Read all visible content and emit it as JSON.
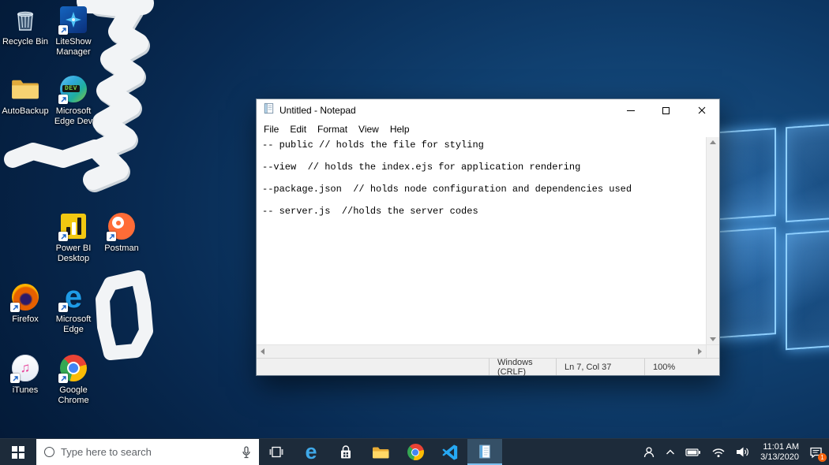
{
  "desktop": {
    "icons": [
      {
        "label": "Recycle Bin"
      },
      {
        "label": "LiteShow Manager"
      },
      {
        "label": "AutoBackup"
      },
      {
        "label": "Microsoft Edge Dev",
        "badge": "DEV"
      },
      {
        "label": "Power BI Desktop"
      },
      {
        "label": "Postman"
      },
      {
        "label": "Firefox"
      },
      {
        "label": "Microsoft Edge"
      },
      {
        "label": "iTunes"
      },
      {
        "label": "Google Chrome"
      }
    ]
  },
  "notepad": {
    "title": "Untitled - Notepad",
    "menu": [
      "File",
      "Edit",
      "Format",
      "View",
      "Help"
    ],
    "lines": [
      "-- public // holds the file for styling",
      "",
      "--view  // holds the index.ejs for application rendering",
      "",
      "--package.json  // holds node configuration and dependencies used",
      "",
      "-- server.js  //holds the server codes"
    ],
    "status": {
      "line_ending": "Windows (CRLF)",
      "cursor": "Ln 7, Col 37",
      "zoom": "100%"
    }
  },
  "taskbar": {
    "search_placeholder": "Type here to search",
    "clock": {
      "time": "11:01 AM",
      "date": "3/13/2020"
    },
    "notification_badge": "1"
  },
  "glyphs": {
    "edge_e": "e",
    "music_note": "♫"
  }
}
